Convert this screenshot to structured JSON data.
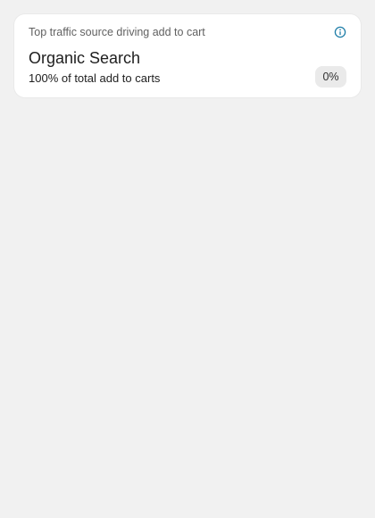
{
  "card": {
    "title": "Top traffic source driving add to cart",
    "source_name": "Organic Search",
    "share_text": "100% of total add to carts",
    "change": "0%",
    "info_icon": "info-circle",
    "colors": {
      "info_icon": "#1f7ea8",
      "badge_bg": "#eaeaea",
      "card_bg": "#ffffff",
      "page_bg": "#f1f1f1"
    }
  }
}
